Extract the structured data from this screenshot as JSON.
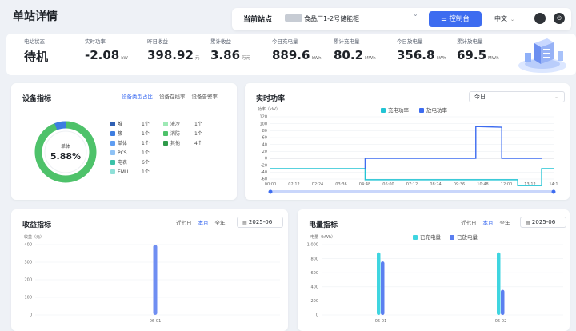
{
  "header": {
    "title": "单站详情",
    "site_label": "当前站点",
    "site_value": "食品厂1-2号储能柜",
    "control_button": "控制台",
    "language": "中文"
  },
  "kpis": [
    {
      "label": "电站状态",
      "value": "待机",
      "unit": ""
    },
    {
      "label": "实时功率",
      "value": "-2.08",
      "unit": "kW"
    },
    {
      "label": "昨日收益",
      "value": "398.92",
      "unit": "元"
    },
    {
      "label": "累计收益",
      "value": "3.86",
      "unit": "万元"
    },
    {
      "label": "今日充电量",
      "value": "889.6",
      "unit": "kWh"
    },
    {
      "label": "累计充电量",
      "value": "80.2",
      "unit": "MWh"
    },
    {
      "label": "今日放电量",
      "value": "356.8",
      "unit": "kWh"
    },
    {
      "label": "累计放电量",
      "value": "69.5",
      "unit": "MWh"
    }
  ],
  "device_metrics": {
    "title": "设备指标",
    "tabs": [
      "设备类型占比",
      "设备在线率",
      "设备告警率"
    ],
    "donut_label": "单体",
    "donut_value": "5.88%",
    "donut_fraction": 0.0588,
    "items": [
      {
        "name": "堆",
        "count": "1个",
        "color": "#2f5fb3"
      },
      {
        "name": "簇",
        "count": "1个",
        "color": "#3d7de0"
      },
      {
        "name": "单体",
        "count": "1个",
        "color": "#5f9df2"
      },
      {
        "name": "PCS",
        "count": "1个",
        "color": "#8fc2f5"
      },
      {
        "name": "电表",
        "count": "6个",
        "color": "#3bc2a8"
      },
      {
        "name": "EMU",
        "count": "1个",
        "color": "#8fe0d8"
      },
      {
        "name": "液冷",
        "count": "1个",
        "color": "#9ee9b5"
      },
      {
        "name": "消防",
        "count": "1个",
        "color": "#4ec26a"
      },
      {
        "name": "其他",
        "count": "4个",
        "color": "#2f9a4a"
      }
    ]
  },
  "realtime": {
    "title": "实时功率",
    "period": "今日",
    "ylabel": "功率（kW）",
    "legend": [
      {
        "name": "充电功率",
        "color": "#22c4d4"
      },
      {
        "name": "放电功率",
        "color": "#3d6cf0"
      }
    ]
  },
  "income": {
    "title": "收益指标",
    "tabs": [
      "近七日",
      "本月",
      "全年"
    ],
    "month": "2025-06"
  },
  "energy": {
    "title": "电量指标",
    "tabs": [
      "近七日",
      "本月",
      "全年"
    ],
    "month": "2025-06",
    "legend": [
      {
        "name": "已充电量",
        "color": "#3fd5e0"
      },
      {
        "name": "已放电量",
        "color": "#5b7ff0"
      }
    ]
  },
  "chart_data": [
    {
      "type": "line",
      "title": "实时功率",
      "ylabel": "功率（kW）",
      "ylim": [
        -60,
        120
      ],
      "yticks": [
        120,
        100,
        80,
        60,
        40,
        20,
        0,
        -20,
        -40,
        -60
      ],
      "x_ticks": [
        "00:00",
        "02:12",
        "02:24",
        "03:36",
        "04:48",
        "06:00",
        "07:12",
        "08:24",
        "09:36",
        "10:48",
        "12:00",
        "13:12",
        "14:1"
      ],
      "series": [
        {
          "name": "充电功率",
          "color": "#22c4d4",
          "points": [
            [
              0,
              -30
            ],
            [
              4.75,
              -30
            ],
            [
              4.75,
              -62
            ],
            [
              12.4,
              -62
            ],
            [
              12.4,
              -79
            ],
            [
              13.6,
              -79
            ],
            [
              13.6,
              -30
            ],
            [
              14.2,
              -30
            ]
          ]
        },
        {
          "name": "放电功率",
          "color": "#3d6cf0",
          "points": [
            [
              4.75,
              -30
            ],
            [
              4.75,
              0
            ],
            [
              10.3,
              0
            ],
            [
              10.3,
              92
            ],
            [
              11.6,
              90
            ],
            [
              11.6,
              0
            ],
            [
              13.6,
              0
            ],
            [
              13.6,
              0
            ]
          ]
        }
      ]
    },
    {
      "type": "bar",
      "title": "收益指标",
      "ylabel": "收益（元）",
      "ylim": [
        0,
        400
      ],
      "yticks": [
        400,
        300,
        200,
        100,
        0
      ],
      "categories": [
        "06-01"
      ],
      "series": [
        {
          "name": "收益",
          "values": [
            398.92
          ]
        }
      ]
    },
    {
      "type": "bar",
      "title": "电量指标",
      "ylabel": "电量（kWh）",
      "ylim": [
        0,
        1000
      ],
      "yticks": [
        "1,000",
        800,
        600,
        400,
        200,
        0
      ],
      "categories": [
        "06-01",
        "06-02"
      ],
      "series": [
        {
          "name": "已充电量",
          "values": [
            889.6,
            889.6
          ]
        },
        {
          "name": "已放电量",
          "values": [
            760,
            356.8
          ]
        }
      ]
    }
  ],
  "colors": {
    "accent": "#3d6cf0",
    "teal": "#22c4d4"
  }
}
